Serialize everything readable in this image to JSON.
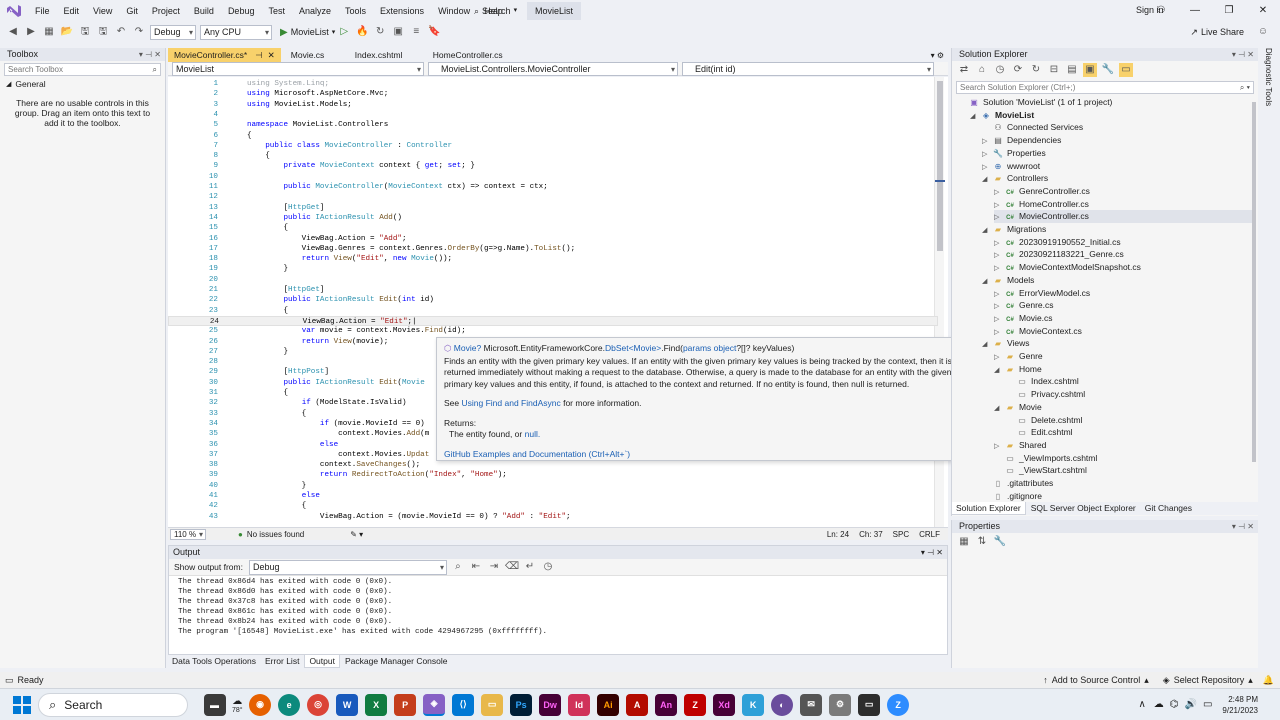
{
  "menubar": {
    "items": [
      "File",
      "Edit",
      "View",
      "Git",
      "Project",
      "Build",
      "Debug",
      "Test",
      "Analyze",
      "Tools",
      "Extensions",
      "Window",
      "Help"
    ],
    "search_label": "Search",
    "project_name": "MovieList",
    "signin": "Sign in"
  },
  "toolbar": {
    "config": "Debug",
    "platform": "Any CPU",
    "run_label": "MovieList",
    "live_share": "Live Share"
  },
  "toolbox": {
    "title": "Toolbox",
    "search_placeholder": "Search Toolbox",
    "group": "General",
    "empty_message": "There are no usable controls in this group. Drag an item onto this text to add it to the toolbox."
  },
  "doc_tabs": [
    "MovieController.cs*",
    "Movie.cs",
    "Index.cshtml",
    "HomeController.cs"
  ],
  "navbar": {
    "project": "MovieList",
    "class": "MovieList.Controllers.MovieController",
    "member": "Edit(int id)"
  },
  "code": {
    "line_numbers": [
      "1",
      "2",
      "3",
      "4",
      "5",
      "6",
      "7",
      "8",
      "9",
      "10",
      "11",
      "12",
      "13",
      "14",
      "15",
      "16",
      "17",
      "18",
      "19",
      "20",
      "21",
      "22",
      "23",
      "24",
      "25",
      "26",
      "27",
      "28",
      "29",
      "30",
      "31",
      "32",
      "33",
      "34",
      "35",
      "36",
      "37",
      "38",
      "39",
      "40",
      "41",
      "42",
      "43"
    ]
  },
  "quickinfo": {
    "type_prefix": "Movie?",
    "namespace": "Microsoft.EntityFrameworkCore.",
    "dbset": "DbSet",
    "generic": "<Movie>",
    "method": ".Find(",
    "params_kw": "params object",
    "params_rest": "?[]? keyValues)",
    "description": "Finds an entity with the given primary key values. If an entity with the given primary key values is being tracked by the context, then it is returned immediately without making a request to the database. Otherwise, a query is made to the database for an entity with the given primary key values and this entity, if found, is attached to the context and returned. If no entity is found, then null is returned.",
    "see_prefix": "See",
    "see_link": "Using Find and FindAsync",
    "see_suffix": "for more information.",
    "returns_label": "Returns:",
    "returns_text": "The entity found, or",
    "returns_null": "null.",
    "github_link": "GitHub Examples and Documentation (Ctrl+Alt+`)"
  },
  "editor_status": {
    "zoom": "110 %",
    "issues": "No issues found",
    "line": "Ln: 24",
    "char": "Ch: 37",
    "spc": "SPC",
    "crlf": "CRLF"
  },
  "output": {
    "title": "Output",
    "show_from_label": "Show output from:",
    "source": "Debug",
    "lines": [
      "The thread 0x86d4 has exited with code 0 (0x0).",
      "The thread 0x86d0 has exited with code 0 (0x0).",
      "The thread 0x37c8 has exited with code 0 (0x0).",
      "The thread 0x861c has exited with code 0 (0x0).",
      "The thread 0x8b24 has exited with code 0 (0x0).",
      "The program '[16548] MovieList.exe' has exited with code 4294967295 (0xffffffff)."
    ]
  },
  "bottom_tabs": [
    "Data Tools Operations",
    "Error List",
    "Output",
    "Package Manager Console"
  ],
  "solution_explorer": {
    "title": "Solution Explorer",
    "search_placeholder": "Search Solution Explorer (Ctrl+;)",
    "items": [
      {
        "label": "Solution 'MovieList' (1 of 1 project)",
        "icon": "solution"
      },
      {
        "label": "MovieList",
        "icon": "project"
      },
      {
        "label": "Connected Services",
        "icon": "services"
      },
      {
        "label": "Dependencies",
        "icon": "deps"
      },
      {
        "label": "Properties",
        "icon": "props"
      },
      {
        "label": "wwwroot",
        "icon": "globe"
      },
      {
        "label": "Controllers",
        "icon": "folder"
      },
      {
        "label": "GenreController.cs",
        "icon": "cs"
      },
      {
        "label": "HomeController.cs",
        "icon": "cs"
      },
      {
        "label": "MovieController.cs",
        "icon": "cs"
      },
      {
        "label": "Migrations",
        "icon": "folder"
      },
      {
        "label": "20230919190552_Initial.cs",
        "icon": "cs"
      },
      {
        "label": "20230921183221_Genre.cs",
        "icon": "cs"
      },
      {
        "label": "MovieContextModelSnapshot.cs",
        "icon": "cs"
      },
      {
        "label": "Models",
        "icon": "folder"
      },
      {
        "label": "ErrorViewModel.cs",
        "icon": "cs"
      },
      {
        "label": "Genre.cs",
        "icon": "cs"
      },
      {
        "label": "Movie.cs",
        "icon": "cs"
      },
      {
        "label": "MovieContext.cs",
        "icon": "cs"
      },
      {
        "label": "Views",
        "icon": "folder"
      },
      {
        "label": "Genre",
        "icon": "folder"
      },
      {
        "label": "Home",
        "icon": "folder"
      },
      {
        "label": "Index.cshtml",
        "icon": "page"
      },
      {
        "label": "Privacy.cshtml",
        "icon": "page"
      },
      {
        "label": "Movie",
        "icon": "folder"
      },
      {
        "label": "Delete.cshtml",
        "icon": "page"
      },
      {
        "label": "Edit.cshtml",
        "icon": "page"
      },
      {
        "label": "Shared",
        "icon": "folder"
      },
      {
        "label": "_ViewImports.cshtml",
        "icon": "page"
      },
      {
        "label": "_ViewStart.cshtml",
        "icon": "page"
      },
      {
        "label": ".gitattributes",
        "icon": "file"
      },
      {
        "label": ".gitignore",
        "icon": "file"
      }
    ]
  },
  "sol_tabs": [
    "Solution Explorer",
    "SQL Server Object Explorer",
    "Git Changes"
  ],
  "properties": {
    "title": "Properties"
  },
  "diagnostic": "Diagnostic Tools",
  "statusbar": {
    "ready": "Ready",
    "source_control": "Add to Source Control",
    "repository": "Select Repository"
  },
  "taskbar": {
    "search": "Search",
    "weather": "78°",
    "time": "2:48 PM",
    "date": "9/21/2023"
  }
}
